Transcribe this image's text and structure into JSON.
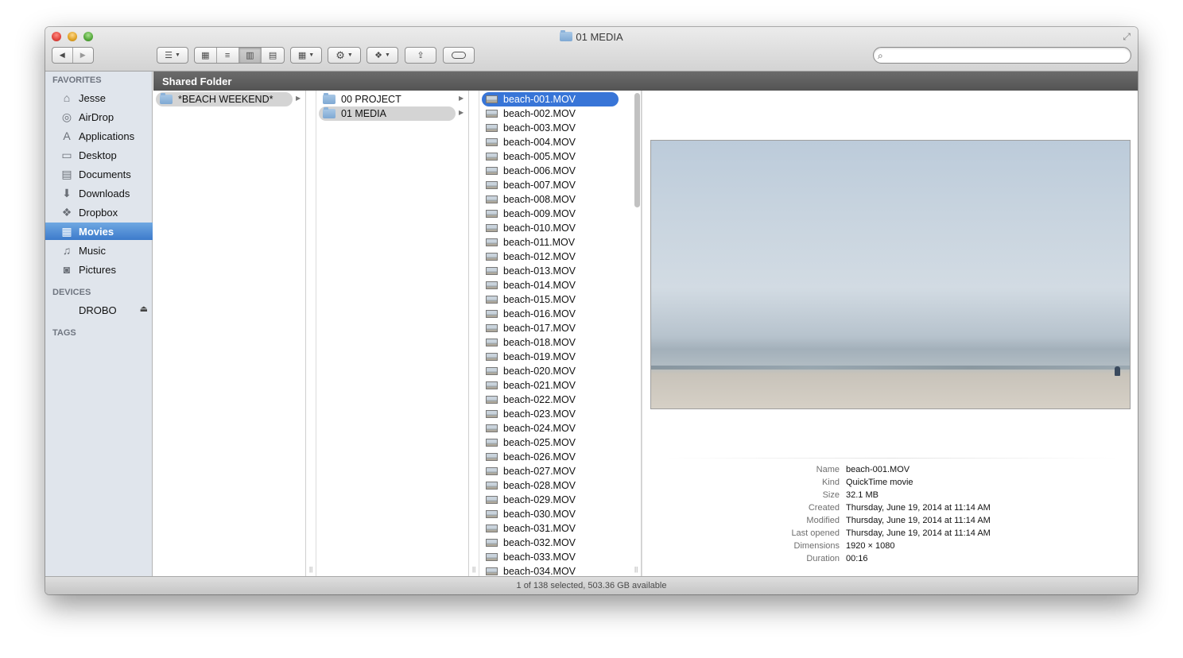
{
  "window": {
    "title": "01 MEDIA"
  },
  "toolbar": {
    "back": "◀",
    "forward": "▶",
    "search": {
      "value": "",
      "placeholder": ""
    }
  },
  "sidebar": {
    "favorites_header": "FAVORITES",
    "favorites": [
      {
        "label": "Jesse",
        "icon": "home-icon"
      },
      {
        "label": "AirDrop",
        "icon": "airdrop-icon"
      },
      {
        "label": "Applications",
        "icon": "applications-icon"
      },
      {
        "label": "Desktop",
        "icon": "desktop-icon"
      },
      {
        "label": "Documents",
        "icon": "documents-icon"
      },
      {
        "label": "Downloads",
        "icon": "downloads-icon"
      },
      {
        "label": "Dropbox",
        "icon": "dropbox-icon"
      },
      {
        "label": "Movies",
        "icon": "movies-icon",
        "selected": true
      },
      {
        "label": "Music",
        "icon": "music-icon"
      },
      {
        "label": "Pictures",
        "icon": "pictures-icon"
      }
    ],
    "devices_header": "DEVICES",
    "devices": [
      {
        "label": "DROBO",
        "icon": "drive-icon"
      }
    ],
    "tags_header": "TAGS"
  },
  "pathbar": {
    "label": "Shared Folder"
  },
  "columns": {
    "col1": [
      {
        "name": "*BEACH WEEKEND*",
        "type": "folder",
        "selected": true
      }
    ],
    "col2": [
      {
        "name": "00 PROJECT",
        "type": "folder"
      },
      {
        "name": "01 MEDIA",
        "type": "folder",
        "selected": true
      }
    ],
    "col3": [
      "beach-001.MOV",
      "beach-002.MOV",
      "beach-003.MOV",
      "beach-004.MOV",
      "beach-005.MOV",
      "beach-006.MOV",
      "beach-007.MOV",
      "beach-008.MOV",
      "beach-009.MOV",
      "beach-010.MOV",
      "beach-011.MOV",
      "beach-012.MOV",
      "beach-013.MOV",
      "beach-014.MOV",
      "beach-015.MOV",
      "beach-016.MOV",
      "beach-017.MOV",
      "beach-018.MOV",
      "beach-019.MOV",
      "beach-020.MOV",
      "beach-021.MOV",
      "beach-022.MOV",
      "beach-023.MOV",
      "beach-024.MOV",
      "beach-025.MOV",
      "beach-026.MOV",
      "beach-027.MOV",
      "beach-028.MOV",
      "beach-029.MOV",
      "beach-030.MOV",
      "beach-031.MOV",
      "beach-032.MOV",
      "beach-033.MOV",
      "beach-034.MOV"
    ],
    "col3_selected_index": 0
  },
  "preview": {
    "info": [
      {
        "label": "Name",
        "value": "beach-001.MOV"
      },
      {
        "label": "Kind",
        "value": "QuickTime movie"
      },
      {
        "label": "Size",
        "value": "32.1 MB"
      },
      {
        "label": "Created",
        "value": "Thursday, June 19, 2014 at 11:14 AM"
      },
      {
        "label": "Modified",
        "value": "Thursday, June 19, 2014 at 11:14 AM"
      },
      {
        "label": "Last opened",
        "value": "Thursday, June 19, 2014 at 11:14 AM"
      },
      {
        "label": "Dimensions",
        "value": "1920 × 1080"
      },
      {
        "label": "Duration",
        "value": "00:16"
      }
    ]
  },
  "statusbar": {
    "text": "1 of 138 selected, 503.36 GB available"
  },
  "colors": {
    "selection_blue": "#3875d7",
    "sidebar_bg": "#e0e5ec",
    "pathbar_bg": "#5e5e5e"
  }
}
